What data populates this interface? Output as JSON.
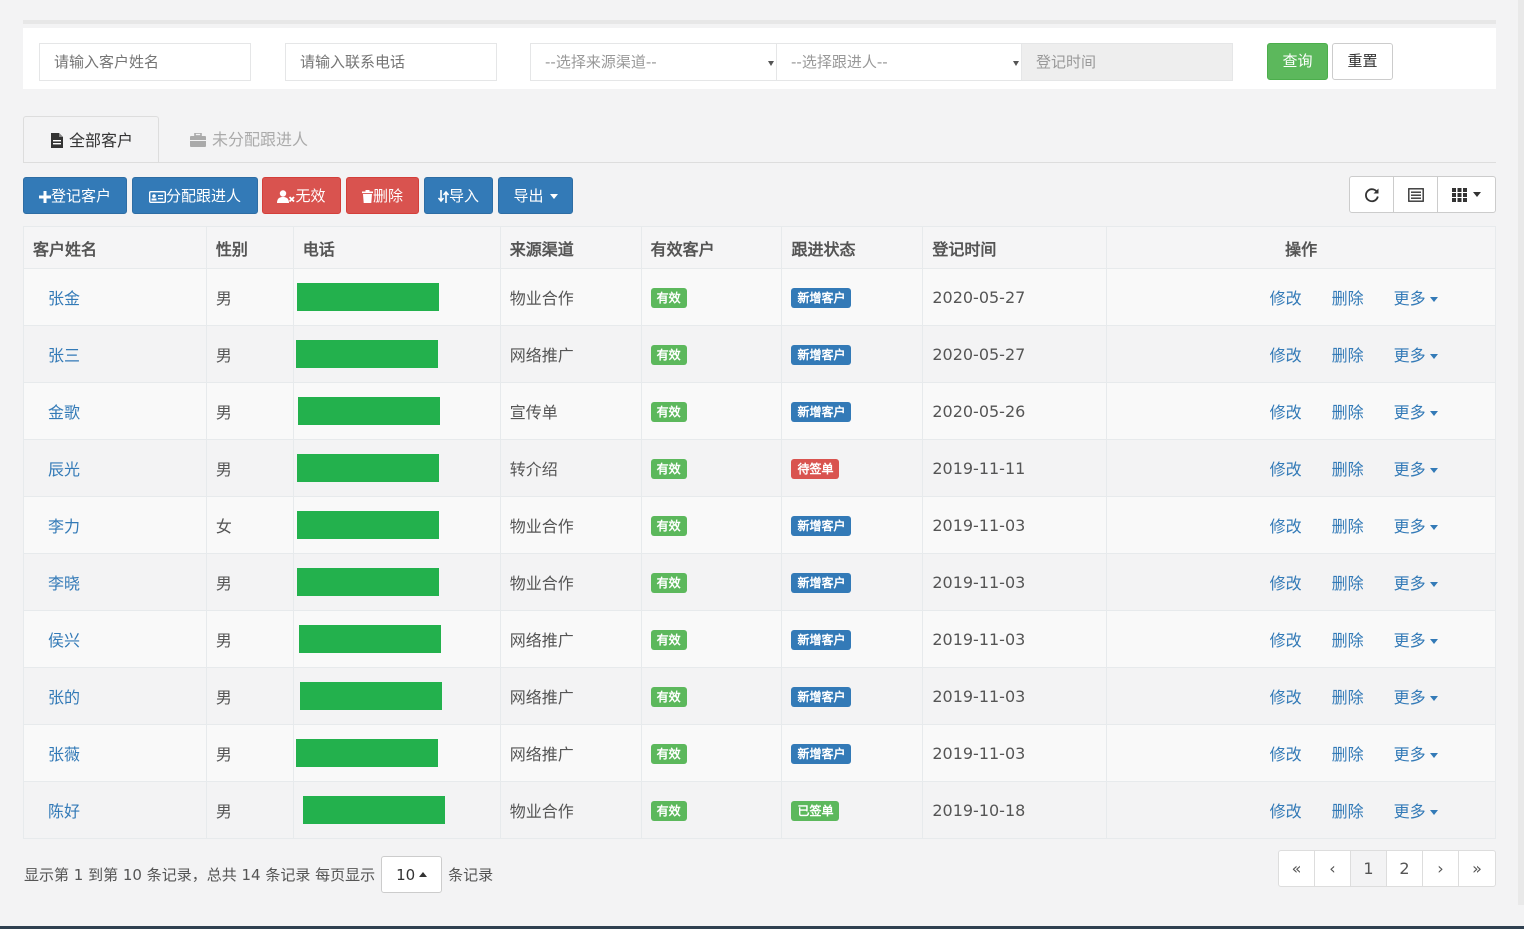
{
  "search": {
    "name_placeholder": "请输入客户姓名",
    "phone_placeholder": "请输入联系电话",
    "source_select": "--选择来源渠道--",
    "follower_select": "--选择跟进人--",
    "date_placeholder": "登记时间",
    "query_label": "查询",
    "reset_label": "重置"
  },
  "tabs": [
    {
      "label": "全部客户",
      "active": true,
      "icon": "file-icon"
    },
    {
      "label": "未分配跟进人",
      "active": false,
      "icon": "briefcase-icon"
    }
  ],
  "toolbar": {
    "register": "登记客户",
    "assign": "分配跟进人",
    "invalid": "无效",
    "delete": "删除",
    "import": "导入",
    "export": "导出"
  },
  "colors": {
    "primary": "#337ab7",
    "danger": "#d9534f",
    "success": "#5cb85c",
    "phone_redaction": "#23b14d"
  },
  "table": {
    "headers": [
      "客户姓名",
      "性别",
      "电话",
      "来源渠道",
      "有效客户",
      "跟进状态",
      "登记时间",
      "操作"
    ],
    "action_edit": "修改",
    "action_delete": "删除",
    "action_more": "更多",
    "rows": [
      {
        "name": "张金",
        "gender": "男",
        "source": "物业合作",
        "valid": "有效",
        "status": "新增客户",
        "status_type": "blue",
        "date": "2020-05-27"
      },
      {
        "name": "张三",
        "gender": "男",
        "source": "网络推广",
        "valid": "有效",
        "status": "新增客户",
        "status_type": "blue",
        "date": "2020-05-27"
      },
      {
        "name": "金歌",
        "gender": "男",
        "source": "宣传单",
        "valid": "有效",
        "status": "新增客户",
        "status_type": "blue",
        "date": "2020-05-26"
      },
      {
        "name": "辰光",
        "gender": "男",
        "source": "转介绍",
        "valid": "有效",
        "status": "待签单",
        "status_type": "red",
        "date": "2019-11-11"
      },
      {
        "name": "李力",
        "gender": "女",
        "source": "物业合作",
        "valid": "有效",
        "status": "新增客户",
        "status_type": "blue",
        "date": "2019-11-03"
      },
      {
        "name": "李晓",
        "gender": "男",
        "source": "物业合作",
        "valid": "有效",
        "status": "新增客户",
        "status_type": "blue",
        "date": "2019-11-03"
      },
      {
        "name": "侯兴",
        "gender": "男",
        "source": "网络推广",
        "valid": "有效",
        "status": "新增客户",
        "status_type": "blue",
        "date": "2019-11-03"
      },
      {
        "name": "张的",
        "gender": "男",
        "source": "网络推广",
        "valid": "有效",
        "status": "新增客户",
        "status_type": "blue",
        "date": "2019-11-03"
      },
      {
        "name": "张薇",
        "gender": "男",
        "source": "网络推广",
        "valid": "有效",
        "status": "新增客户",
        "status_type": "blue",
        "date": "2019-11-03"
      },
      {
        "name": "陈好",
        "gender": "男",
        "source": "物业合作",
        "valid": "有效",
        "status": "已签单",
        "status_type": "green",
        "date": "2019-10-18"
      }
    ]
  },
  "footer": {
    "info": "显示第 1 到第 10 条记录，总共 14 条记录 每页显示",
    "page_size": "10",
    "suffix": "条记录"
  },
  "pagination": {
    "first": "«",
    "prev": "‹",
    "pages": [
      "1",
      "2"
    ],
    "current": "1",
    "next": "›",
    "last": "»"
  }
}
